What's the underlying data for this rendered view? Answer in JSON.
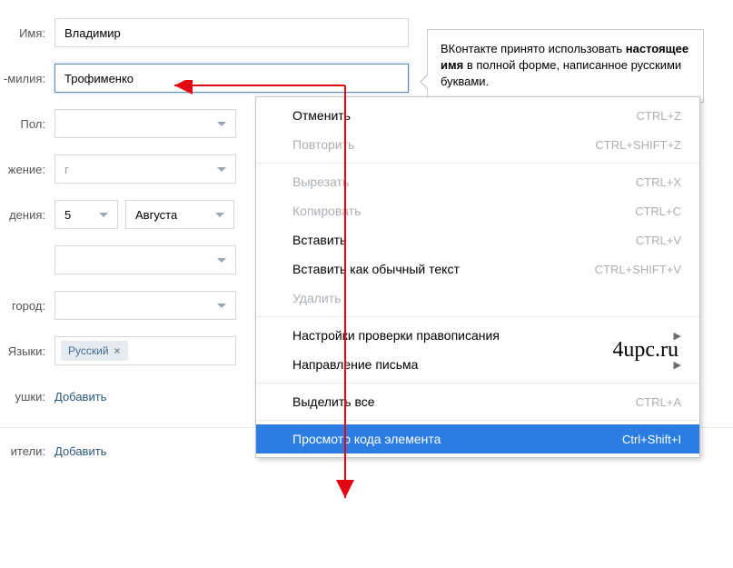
{
  "form": {
    "name_label": "Имя:",
    "name_value": "Владимир",
    "surname_label": "-милия:",
    "surname_value": "Трофименко",
    "gender_label": "Пол:",
    "gender_value": "",
    "relation_label": "жение:",
    "relation_value": "г",
    "birth_label": "дения:",
    "birth_day": "5",
    "birth_month": "Августа",
    "empty1": "",
    "city_label": "город:",
    "city_value": "",
    "lang_label": "Языки:",
    "lang_tag": "Русский",
    "grand_label": "ушки:",
    "grand_value": "Добавить",
    "parents_label": "ители:",
    "parents_value": "Добавить"
  },
  "tooltip": {
    "line1": "ВКонтакте принято использовать ",
    "bold": "настоящее имя",
    "line2": " в полной форме, написанное русскими буквами."
  },
  "ctx": {
    "undo": "Отменить",
    "undo_k": "CTRL+Z",
    "redo": "Повторить",
    "redo_k": "CTRL+SHIFT+Z",
    "cut": "Вырезать",
    "cut_k": "CTRL+X",
    "copy": "Копировать",
    "copy_k": "CTRL+C",
    "paste": "Вставить",
    "paste_k": "CTRL+V",
    "paste_plain": "Вставить как обычный текст",
    "paste_plain_k": "CTRL+SHIFT+V",
    "delete": "Удалить",
    "spell": "Настройки проверки правописания",
    "direction": "Направление письма",
    "select_all": "Выделить все",
    "select_all_k": "CTRL+A",
    "inspect": "Просмотр кода элемента",
    "inspect_k": "Ctrl+Shift+I"
  },
  "watermark": "4upc.ru"
}
